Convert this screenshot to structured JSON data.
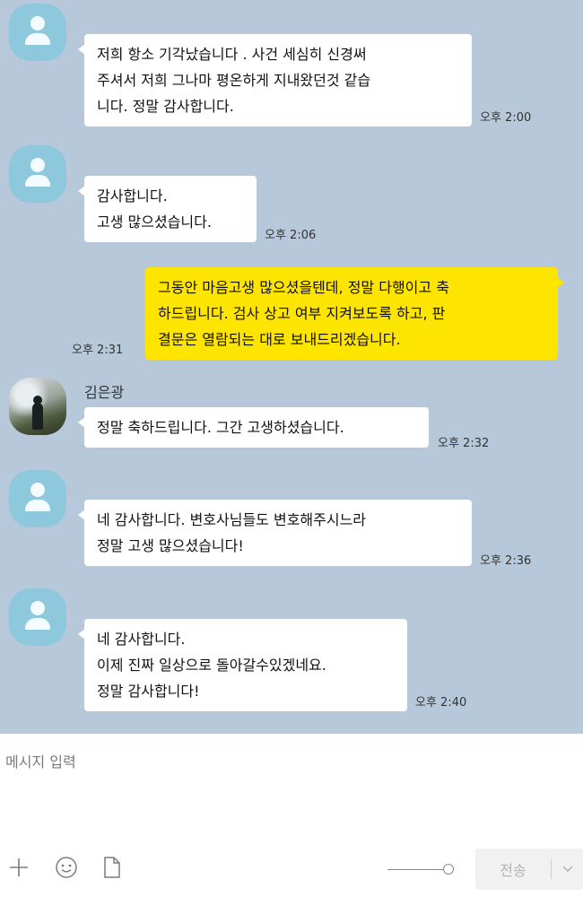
{
  "colors": {
    "chat_background": "#b6c8d9",
    "incoming_bubble": "#ffffff",
    "outgoing_bubble": "#fee500",
    "default_avatar": "#8dc8dd"
  },
  "messages": [
    {
      "direction": "in",
      "avatar": "default-avatar",
      "sender": "",
      "text": "저희 항소 기각났습니다 . 사건 세심히 신경써\n주셔서 저희 그나마 평온하게 지내왔던것 같습\n니다. 정말 감사합니다.",
      "time": "오후 2:00"
    },
    {
      "direction": "in",
      "avatar": "default-avatar",
      "sender": "",
      "text": "감사합니다.\n고생 많으셨습니다.",
      "time": "오후 2:06"
    },
    {
      "direction": "out",
      "avatar": "",
      "sender": "",
      "text": "그동안 마음고생 많으셨을텐데, 정말 다행이고 축\n하드립니다. 검사 상고 여부 지켜보도록 하고, 판\n결문은 열람되는 대로 보내드리겠습니다.",
      "time": "오후 2:31"
    },
    {
      "direction": "in",
      "avatar": "photo-avatar",
      "sender": "김은광",
      "text": "정말 축하드립니다. 그간 고생하셨습니다.",
      "time": "오후 2:32"
    },
    {
      "direction": "in",
      "avatar": "default-avatar",
      "sender": "",
      "text": "네 감사합니다. 변호사님들도 변호해주시느라\n정말 고생 많으셨습니다!",
      "time": "오후 2:36"
    },
    {
      "direction": "in",
      "avatar": "default-avatar",
      "sender": "",
      "text": "네 감사합니다.\n이제 진짜 일상으로 돌아갈수있겠네요.\n정말 감사합니다!",
      "time": "오후 2:40"
    }
  ],
  "composer": {
    "placeholder": "메시지 입력",
    "value": "",
    "tools": [
      "plus-icon",
      "emoticon-icon",
      "file-icon"
    ],
    "send_label": "전송",
    "send_options_icon": "chevron-down-icon"
  }
}
